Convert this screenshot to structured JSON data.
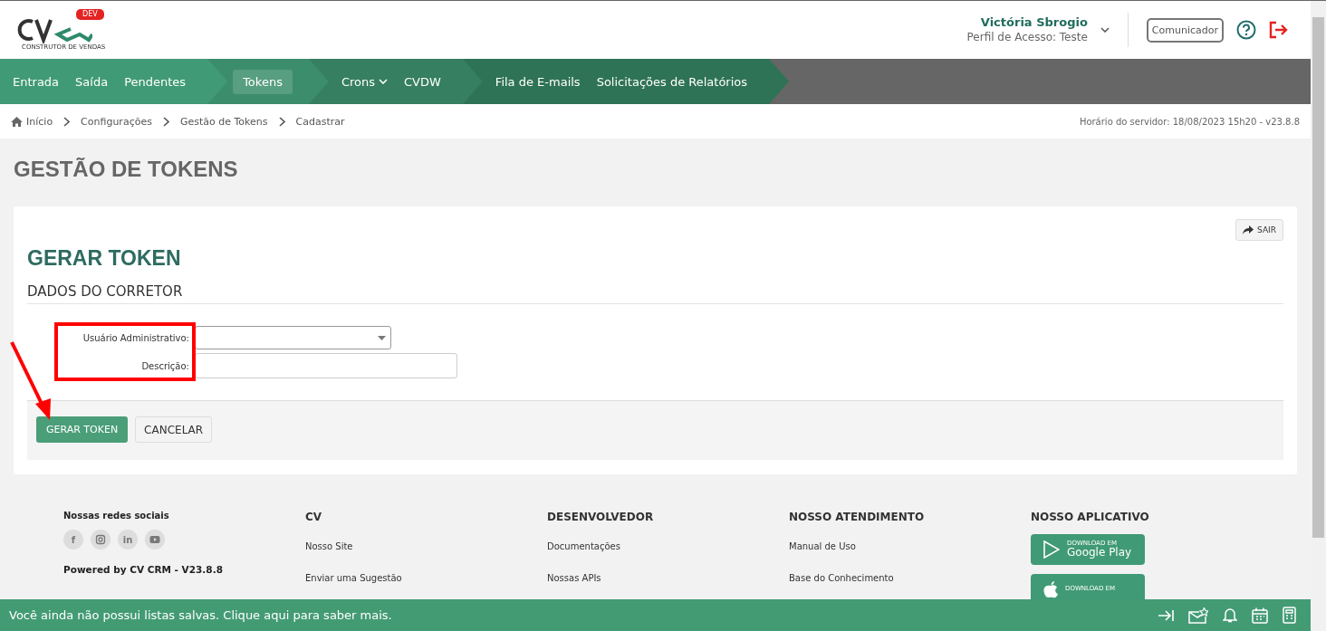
{
  "header": {
    "logo_badge": "DEV",
    "logo_caption": "CONSTRUTOR DE VENDAS",
    "user_name": "Victória Sbrogio",
    "user_profile": "Perfil de Acesso: Teste",
    "communicator_button": "Comunicador"
  },
  "nav": [
    {
      "items": [
        {
          "label": "Entrada",
          "selected": false,
          "dropdown": false
        },
        {
          "label": "Saída",
          "selected": false,
          "dropdown": false
        },
        {
          "label": "Pendentes",
          "selected": false,
          "dropdown": false
        }
      ]
    },
    {
      "items": [
        {
          "label": "Tokens",
          "selected": true,
          "dropdown": false
        }
      ]
    },
    {
      "items": [
        {
          "label": "Crons",
          "selected": false,
          "dropdown": true
        },
        {
          "label": "CVDW",
          "selected": false,
          "dropdown": false
        }
      ]
    },
    {
      "items": [
        {
          "label": "Fila de E-mails",
          "selected": false,
          "dropdown": false
        },
        {
          "label": "Solicitações de Relatórios",
          "selected": false,
          "dropdown": false
        }
      ]
    }
  ],
  "breadcrumb": [
    "Início",
    "Configurações",
    "Gestão de Tokens",
    "Cadastrar"
  ],
  "server_time": "Horário do servidor: 18/08/2023 15h20 - v23.8.8",
  "page_title": "GESTÃO DE TOKENS",
  "card": {
    "exit_button": "SAIR",
    "title": "GERAR TOKEN",
    "section": "DADOS DO CORRETOR",
    "fields": [
      {
        "kind": "select",
        "label": "Usuário Administrativo:"
      },
      {
        "kind": "text",
        "label": "Descrição:"
      }
    ],
    "primary_button": "GERAR TOKEN",
    "secondary_button": "CANCELAR"
  },
  "footer": {
    "social_title": "Nossas redes sociais",
    "social_letters": {
      "facebook": "f",
      "linkedin": "in"
    },
    "powered_by": "Powered by CV CRM - V23.8.8",
    "columns": [
      {
        "title": "CV",
        "links": [
          "Nosso Site",
          "Enviar uma Sugestão"
        ]
      },
      {
        "title": "DESENVOLVEDOR",
        "links": [
          "Documentações",
          "Nossas APIs"
        ]
      },
      {
        "title": "NOSSO ATENDIMENTO",
        "links": [
          "Manual de Uso",
          "Base do Conhecimento"
        ]
      }
    ],
    "app_title": "NOSSO APLICATIVO",
    "badges": [
      {
        "kind": "google",
        "small": "DOWNLOAD EM",
        "store": "Google Play"
      },
      {
        "kind": "apple",
        "small": "DOWNLOAD EM"
      }
    ]
  },
  "bottom_bar": {
    "message": "Você ainda não possui listas salvas. Clique aqui para saber mais."
  }
}
